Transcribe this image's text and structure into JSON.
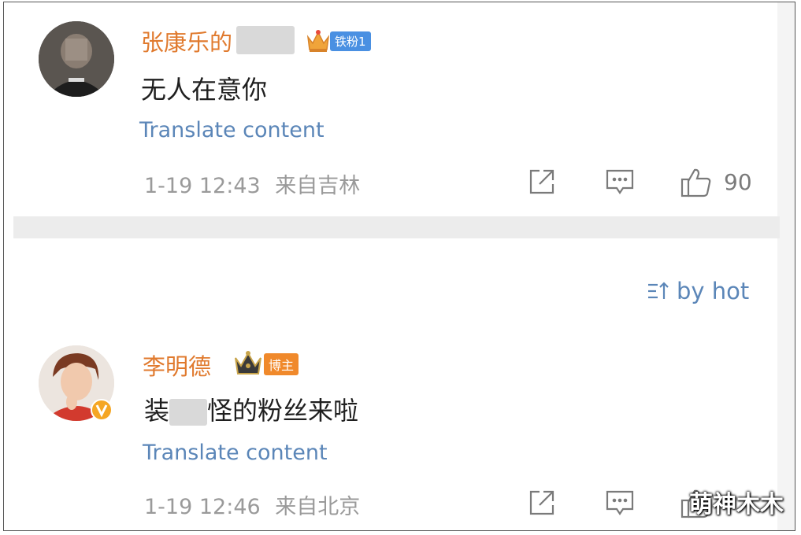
{
  "comments": [
    {
      "username": "张康乐的",
      "fan_badge": "铁粉1",
      "text": "无人在意你",
      "translate_label": "Translate content",
      "timestamp": "1-19 12:43",
      "location": "来自吉林",
      "likes": "90"
    },
    {
      "username": "李明德",
      "fan_badge": "博主",
      "text_part1": "装",
      "text_part2": "怪的粉丝来啦",
      "translate_label": "Translate content",
      "timestamp": "1-19 12:46",
      "location": "来自北京"
    }
  ],
  "sort": {
    "label": "by hot"
  },
  "watermark": "萌神木木",
  "colors": {
    "username": "#e07a2e",
    "link": "#5b86b8",
    "meta": "#9a9a9a",
    "divider": "#ececec",
    "tie_fen_badge": "#4a90e2",
    "bozhu_badge": "#f0892b"
  }
}
